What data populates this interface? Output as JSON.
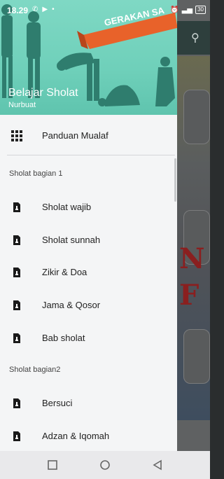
{
  "status_bar": {
    "time": "18.29",
    "battery": "30"
  },
  "drawer_header": {
    "banner_text": "GERAKAN SA",
    "title": "Belajar Sholat",
    "subtitle": "Nurbuat"
  },
  "menu": {
    "top_item": {
      "label": "Panduan Mualaf",
      "icon": "apps-grid-icon"
    },
    "section1": {
      "title": "Sholat bagian 1",
      "items": [
        {
          "label": "Sholat wajib",
          "icon": "document-icon"
        },
        {
          "label": "Sholat sunnah",
          "icon": "document-icon"
        },
        {
          "label": "Zikir & Doa",
          "icon": "document-icon"
        },
        {
          "label": "Jama & Qosor",
          "icon": "document-icon"
        },
        {
          "label": "Bab sholat",
          "icon": "document-icon"
        }
      ]
    },
    "section2": {
      "title": "Sholat bagian2",
      "items": [
        {
          "label": "Bersuci",
          "icon": "document-icon"
        },
        {
          "label": "Adzan & Iqomah",
          "icon": "document-icon"
        }
      ]
    }
  },
  "navigation_bar": {
    "buttons": [
      "recents-button",
      "home-button",
      "back-button"
    ]
  },
  "colors": {
    "header_teal": "#6fd0ba",
    "silhouette": "#2f7d6e",
    "ribbon": "#e8622a",
    "drawer_bg": "#f4f5f6"
  }
}
